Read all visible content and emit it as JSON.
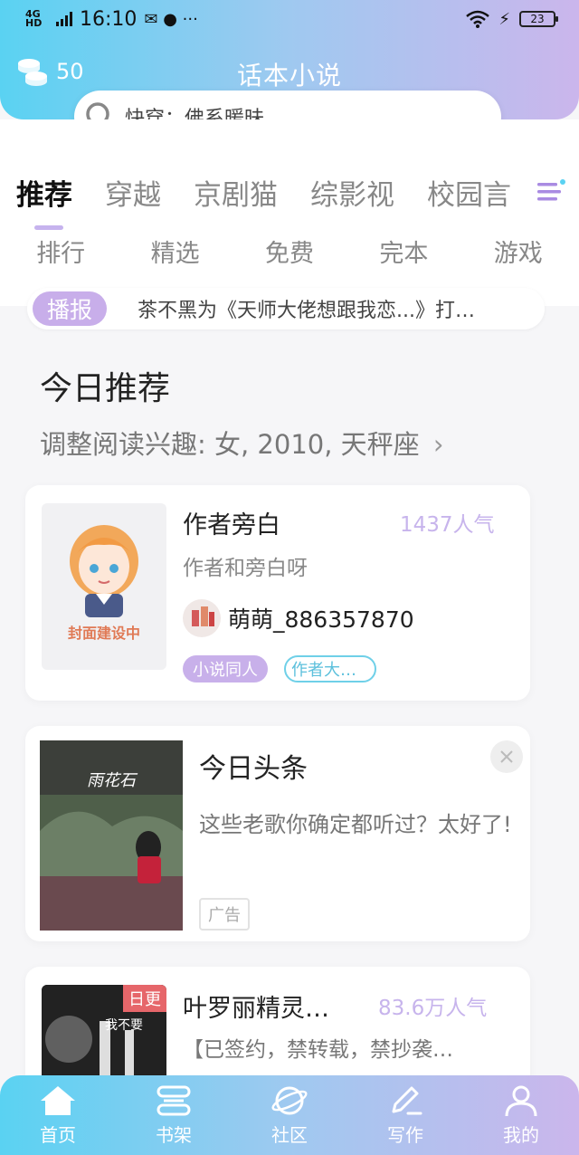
{
  "status_bar": {
    "network": "4G HD",
    "time": "16:10",
    "battery": "23"
  },
  "header": {
    "coins": "50",
    "title": "话本小说"
  },
  "search": {
    "placeholder": "快穿：佛系暖昧"
  },
  "tabs": [
    "推荐",
    "穿越",
    "京剧猫",
    "综影视",
    "校园言"
  ],
  "subtabs": [
    "排行",
    "精选",
    "免费",
    "完本",
    "游戏"
  ],
  "broadcast": {
    "tag": "播报",
    "text": "茶不黑为《天师大佬想跟我恋...》打…"
  },
  "section": {
    "title": "今日推荐",
    "interest": "调整阅读兴趣: 女, 2010, 天秤座"
  },
  "book1": {
    "title": "作者旁白",
    "popularity": "1437人气",
    "description": "作者和旁白呀",
    "author": "萌萌_886357870",
    "cover_label": "封面建设中",
    "tags": [
      "小说同人",
      "作者大…"
    ]
  },
  "ad": {
    "title": "今日头条",
    "description": "这些老歌你确定都听过？太好了!",
    "badge": "广告",
    "image_text": "雨花石"
  },
  "book2": {
    "title": "叶罗丽精灵…",
    "popularity": "83.6万人气",
    "description": "【已签约，禁转载，禁抄袭…",
    "badge": "日更",
    "cover_text": "我不要"
  },
  "bottom_nav": [
    "首页",
    "书架",
    "社区",
    "写作",
    "我的"
  ]
}
